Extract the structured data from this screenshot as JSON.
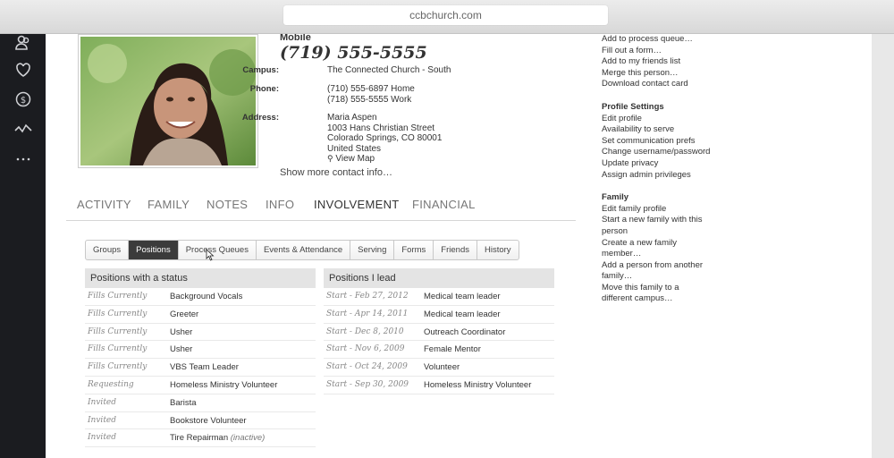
{
  "browser": {
    "url": "ccbchurch.com"
  },
  "profile": {
    "mobile_label": "Mobile",
    "mobile_number": "(719) 555-5555",
    "campus_label": "Campus:",
    "campus": "The Connected Church - South",
    "phone_label": "Phone:",
    "phone_home": "(710) 555-6897 Home",
    "phone_work": "(718) 555-5555 Work",
    "address_label": "Address:",
    "address_name": "Maria Aspen",
    "address_street": "1003 Hans Christian Street",
    "address_city": "Colorado Springs, CO 80001",
    "address_country": "United States",
    "view_map": "View Map",
    "show_more": "Show more contact info…"
  },
  "main_tabs": [
    "ACTIVITY",
    "FAMILY",
    "NOTES",
    "INFO",
    "INVOLVEMENT",
    "FINANCIAL"
  ],
  "sub_tabs": [
    "Groups",
    "Positions",
    "Process Queues",
    "Events & Attendance",
    "Serving",
    "Forms",
    "Friends",
    "History"
  ],
  "positions_status": {
    "title": "Positions with a status",
    "rows": [
      {
        "status": "Fills Currently",
        "name": "Background Vocals",
        "note": ""
      },
      {
        "status": "Fills Currently",
        "name": "Greeter",
        "note": ""
      },
      {
        "status": "Fills Currently",
        "name": "Usher",
        "note": ""
      },
      {
        "status": "Fills Currently",
        "name": "Usher",
        "note": ""
      },
      {
        "status": "Fills Currently",
        "name": "VBS Team Leader",
        "note": ""
      },
      {
        "status": "Requesting",
        "name": "Homeless Ministry Volunteer",
        "note": ""
      },
      {
        "status": "Invited",
        "name": "Barista",
        "note": ""
      },
      {
        "status": "Invited",
        "name": "Bookstore Volunteer",
        "note": ""
      },
      {
        "status": "Invited",
        "name": "Tire Repairman",
        "note": "(inactive)"
      }
    ]
  },
  "positions_lead": {
    "title": "Positions I lead",
    "rows": [
      {
        "start": "Start - Feb 27, 2012",
        "name": "Medical team leader"
      },
      {
        "start": "Start - Apr 14, 2011",
        "name": "Medical team leader"
      },
      {
        "start": "Start - Dec 8, 2010",
        "name": "Outreach Coordinator"
      },
      {
        "start": "Start - Nov 6, 2009",
        "name": "Female Mentor"
      },
      {
        "start": "Start - Oct 24, 2009",
        "name": "Volunteer"
      },
      {
        "start": "Start - Sep 30, 2009",
        "name": "Homeless Ministry Volunteer"
      }
    ]
  },
  "actions": {
    "top_items": [
      "Add to process queue…",
      "Fill out a form…",
      "Add to my friends list",
      "Merge this person…",
      "Download contact card"
    ],
    "profile_settings_heading": "Profile Settings",
    "profile_settings_items": [
      "Edit profile",
      "Availability to serve",
      "Set communication prefs",
      "Change username/password",
      "Update privacy",
      "Assign admin privileges"
    ],
    "family_heading": "Family",
    "family_items": [
      "Edit family profile",
      "Start a new family with this person",
      "Create a new family member…",
      "Add a person from another family…",
      "Move this family to a different campus…"
    ]
  },
  "nav_icons": [
    "people-icon",
    "heart-icon",
    "dollar-icon",
    "activity-icon",
    "more-icon"
  ]
}
